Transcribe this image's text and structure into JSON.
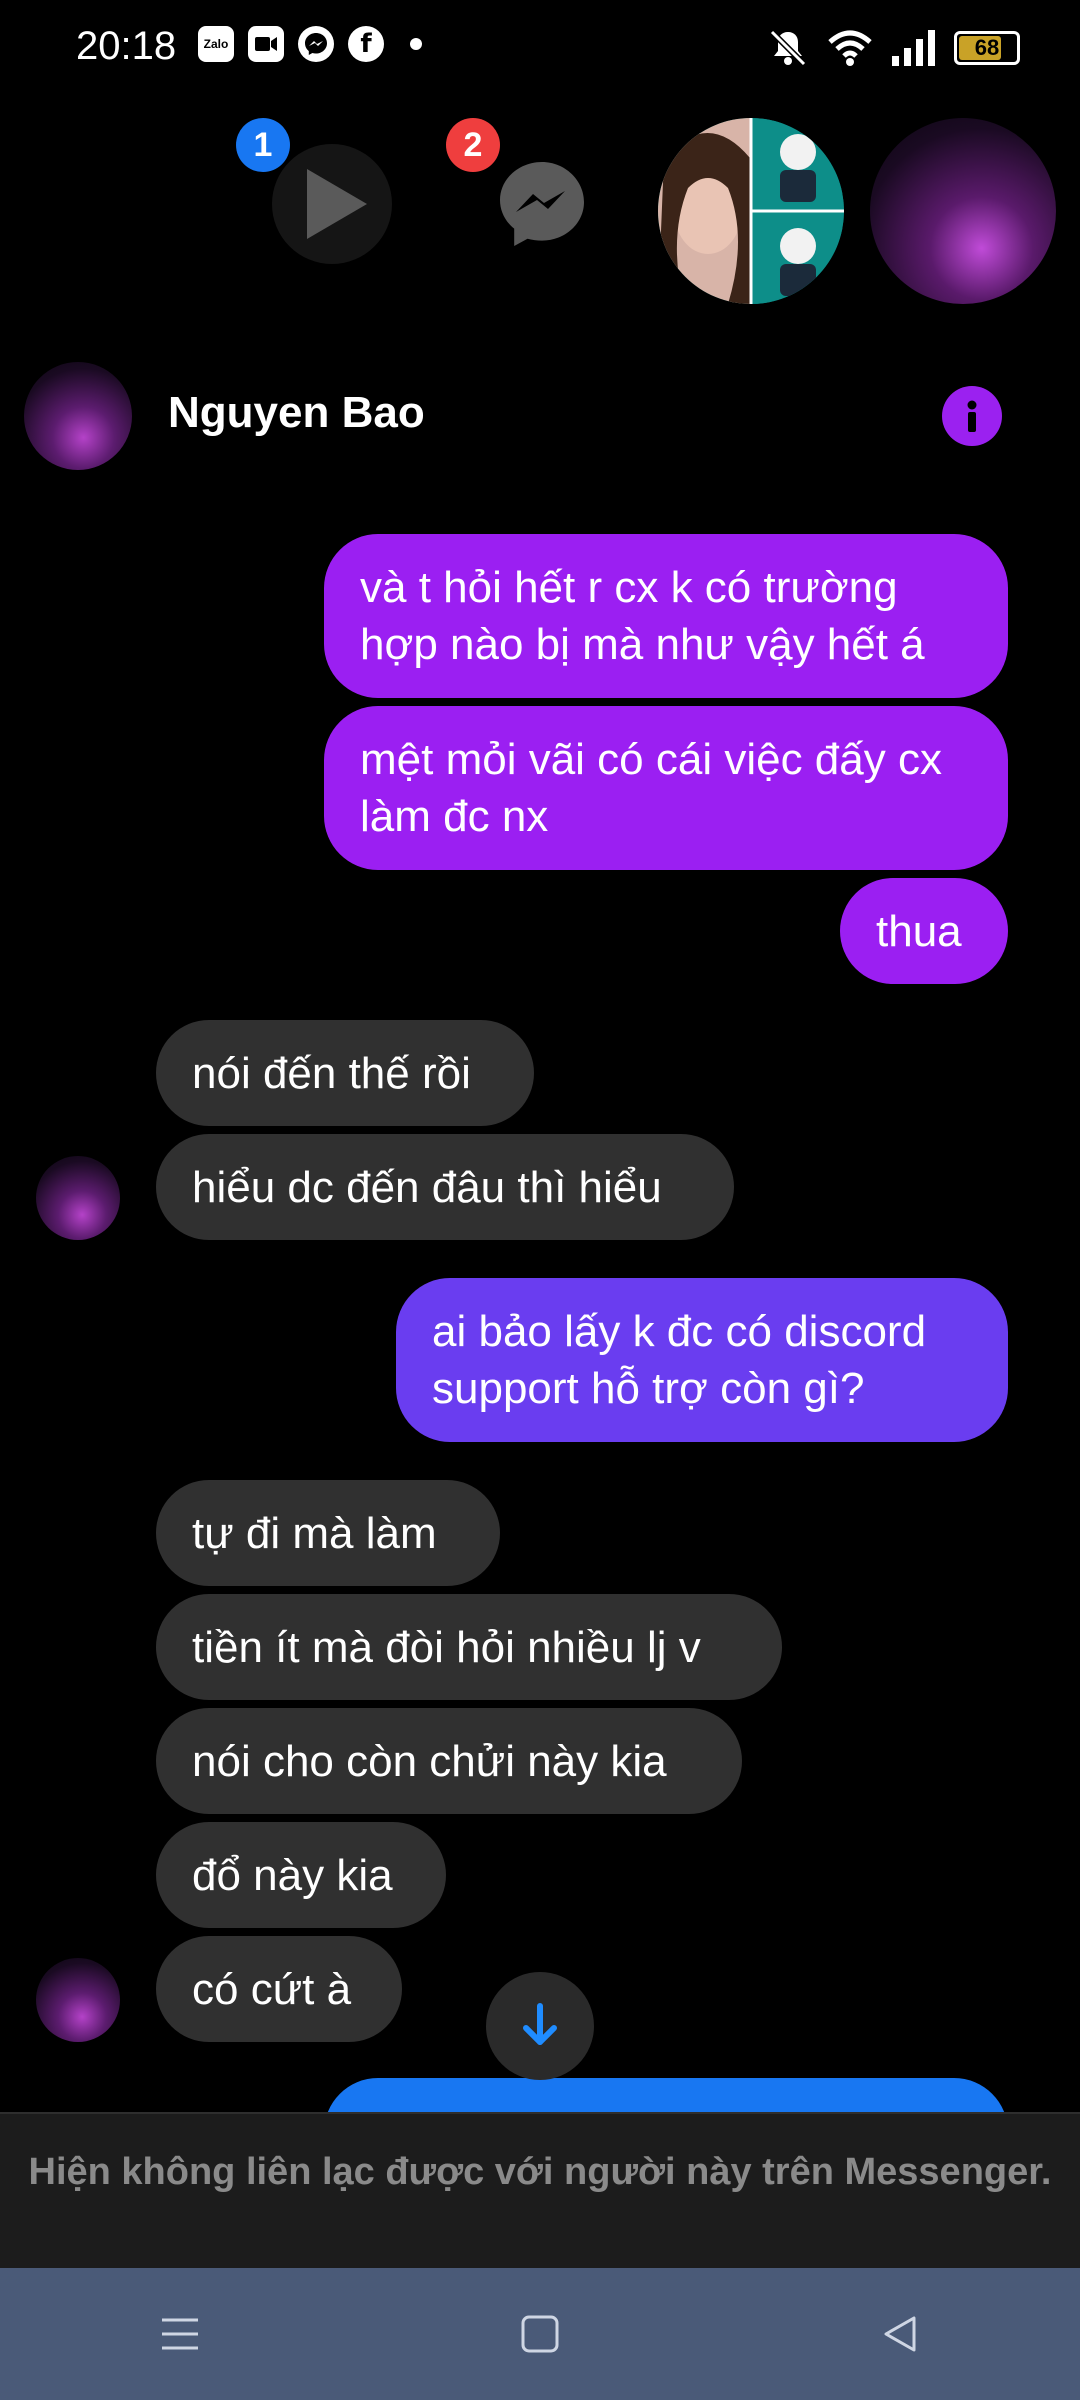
{
  "status_bar": {
    "time": "20:18",
    "notification_apps": [
      "Zalo",
      "video-icon",
      "messenger-icon",
      "facebook-icon"
    ],
    "battery": "68"
  },
  "chat_heads": {
    "badge_1": "1",
    "badge_2": "2"
  },
  "header": {
    "contact_name": "Nguyen Bao",
    "info_icon": "info-icon"
  },
  "messages": [
    {
      "direction": "out",
      "text": "và t hỏi hết r cx k có trường hợp nào bị mà như vậy hết á"
    },
    {
      "direction": "out",
      "text": "mệt mỏi vãi có cái việc đấy cx làm đc nx"
    },
    {
      "direction": "out",
      "text": "thua"
    },
    {
      "direction": "in",
      "text": "nói đến thế rồi"
    },
    {
      "direction": "in",
      "text": "hiểu dc đến đâu thì hiểu"
    },
    {
      "direction": "out",
      "text": "ai bảo lấy k đc có discord support hỗ trợ còn gì?"
    },
    {
      "direction": "in",
      "text": "tự đi mà làm"
    },
    {
      "direction": "in",
      "text": "tiền ít mà đòi hỏi nhiều lj v"
    },
    {
      "direction": "in",
      "text": "nói cho còn chửi này kia"
    },
    {
      "direction": "in",
      "text": "đổ này kia"
    },
    {
      "direction": "in",
      "text": "có cứt à"
    }
  ],
  "footer": {
    "notice": "Hiện không liên lạc được với người này trên Messenger."
  },
  "colors": {
    "outgoing_bubble": "#9b1ff2",
    "outgoing_bubble_alt": "#6a3df0",
    "incoming_bubble": "#303030",
    "accent": "#9b21f0",
    "nav_bar": "#4a5a78"
  }
}
